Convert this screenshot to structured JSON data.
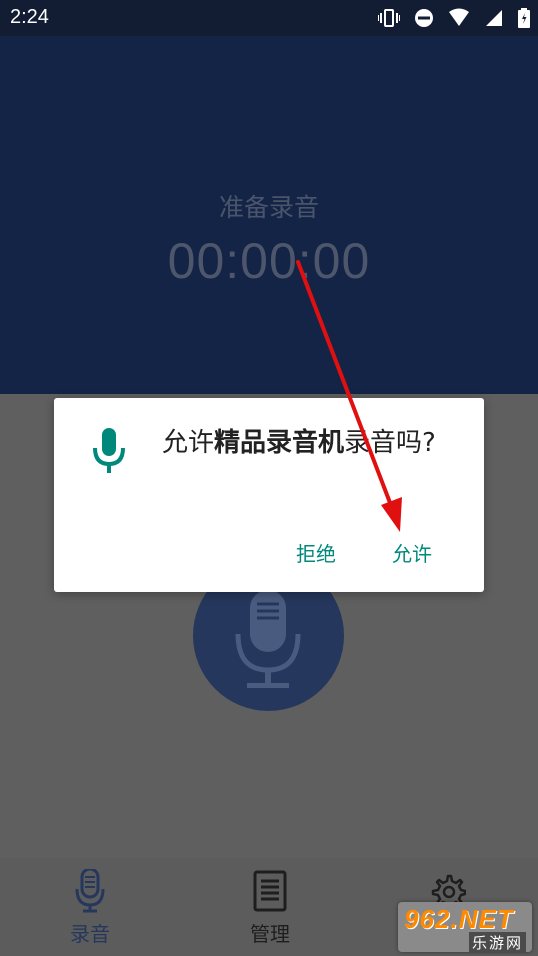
{
  "status_bar": {
    "time": "2:24"
  },
  "recorder": {
    "state_label": "准备录音",
    "timer": "00:00:00"
  },
  "dialog": {
    "message_prefix": "允许",
    "app_name": "精品录音机",
    "message_suffix": "录音吗?",
    "deny_label": "拒绝",
    "allow_label": "允许"
  },
  "bottom_nav": {
    "record_label": "录音",
    "manage_label": "管理",
    "settings_label": "设置"
  },
  "watermark": {
    "logo_text": "962.NET",
    "site_name": "乐游网"
  },
  "colors": {
    "primary": "#132447",
    "accent": "#00897b",
    "arrow": "#e01010"
  }
}
